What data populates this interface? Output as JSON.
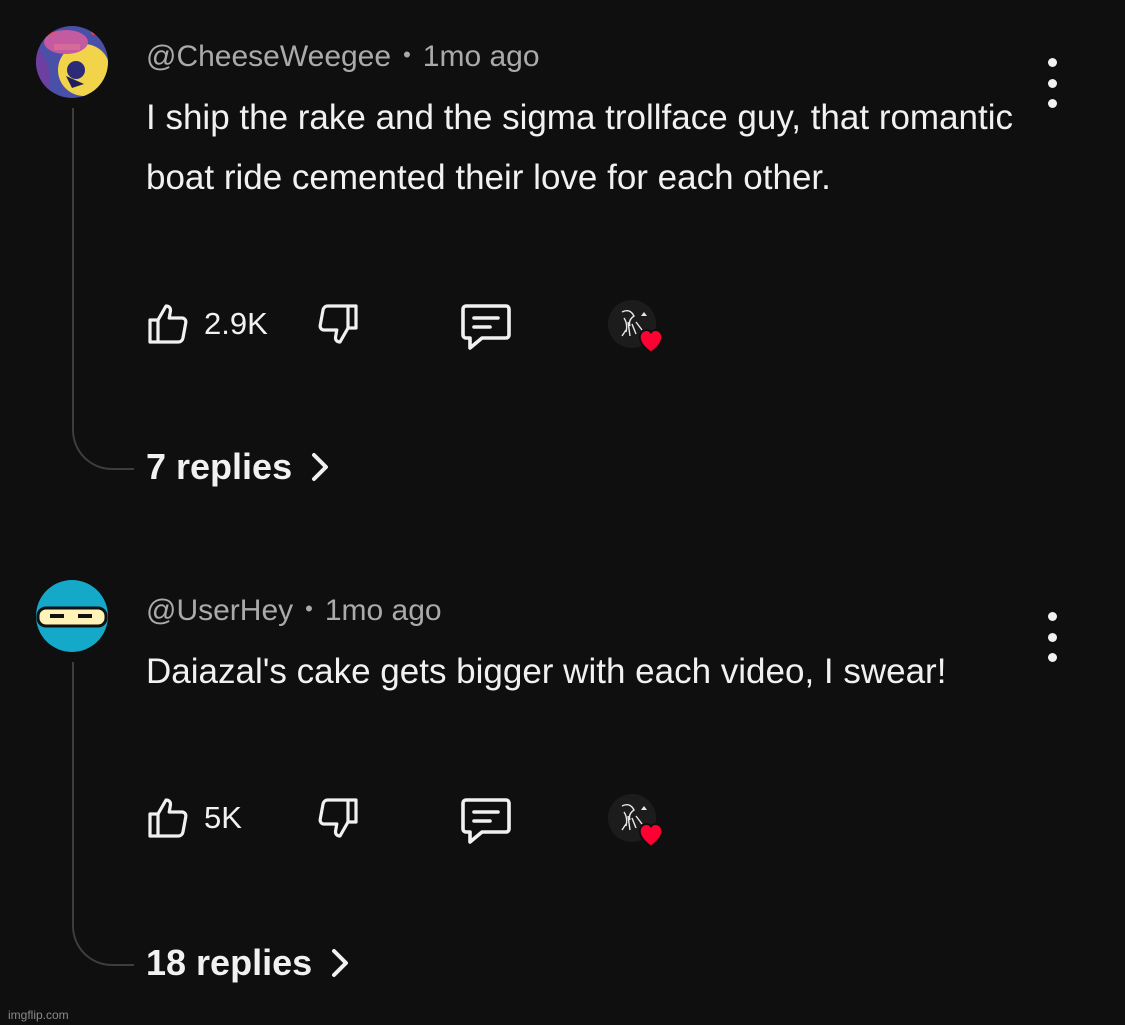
{
  "comments": [
    {
      "username": "@CheeseWeegee",
      "separator": "•",
      "time": "1mo ago",
      "text": "I ship the rake and the sigma trollface guy, that romantic boat ride cemented their love for each other.",
      "likes": "2.9K",
      "replies_label": "7 replies",
      "avatar_icon": "purple-yellow-avatar-icon"
    },
    {
      "username": "@UserHey",
      "separator": "•",
      "time": "1mo ago",
      "text": "Daiazal's cake gets bigger with each video, I swear!",
      "likes": "5K",
      "replies_label": "18 replies",
      "avatar_icon": "blue-ninja-avatar-icon"
    }
  ],
  "colors": {
    "background": "#0f0f0f",
    "text": "#f1f1f1",
    "meta": "#aaaaaa",
    "heart": "#ff0033",
    "avatar_blue": "#14a8c9"
  },
  "watermark": "imgflip.com"
}
